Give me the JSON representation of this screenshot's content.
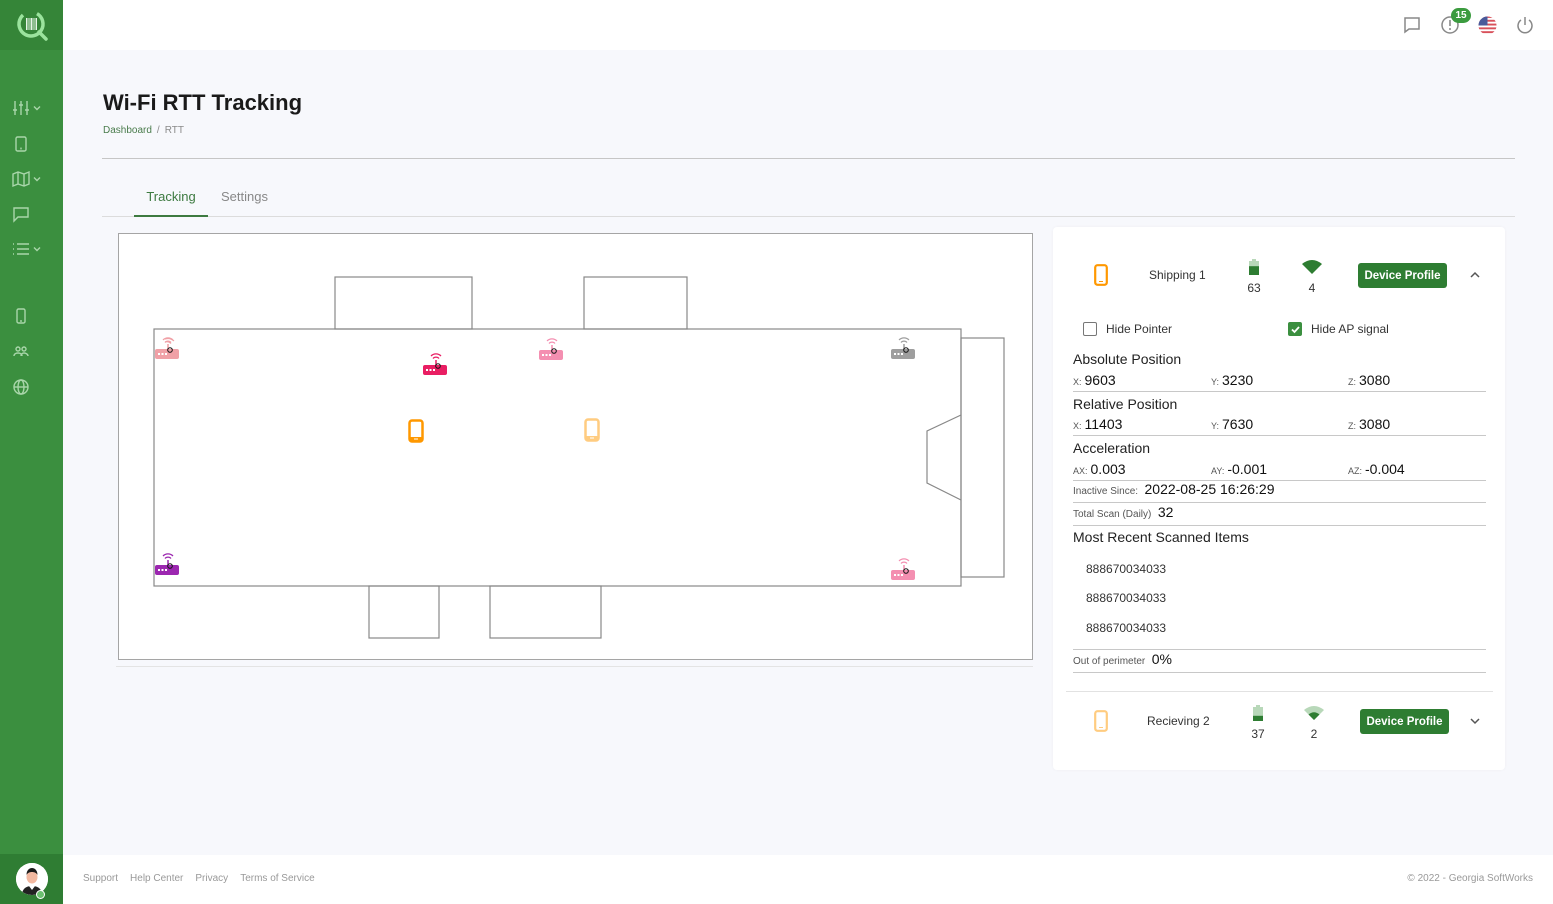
{
  "app": {
    "brand_color": "#3b8f3f",
    "accent": "#2e7d32"
  },
  "sidebar": {
    "logo_icon": "barcode-search-logo",
    "items": [
      {
        "name": "sliders-icon",
        "has_submenu": true
      },
      {
        "name": "tablet-icon",
        "has_submenu": false
      },
      {
        "name": "map-icon",
        "has_submenu": true
      },
      {
        "name": "chat-icon",
        "has_submenu": false
      },
      {
        "name": "list-icon",
        "has_submenu": true
      },
      {
        "name": "phone-icon",
        "has_submenu": false
      },
      {
        "name": "users-icon",
        "has_submenu": false
      },
      {
        "name": "globe-icon",
        "has_submenu": false
      }
    ]
  },
  "topbar": {
    "notifications_count": "15",
    "icons": [
      "message-icon",
      "alert-icon",
      "us-flag-icon",
      "power-icon"
    ]
  },
  "header": {
    "title": "Wi-Fi RTT Tracking",
    "breadcrumb": [
      {
        "label": "Dashboard"
      },
      {
        "label": "RTT"
      }
    ]
  },
  "tabs": [
    {
      "label": "Tracking",
      "active": true
    },
    {
      "label": "Settings",
      "active": false
    }
  ],
  "map": {
    "access_points": [
      {
        "color": "#f0a0a6"
      },
      {
        "color": "#e91e63"
      },
      {
        "color": "#f48fb1"
      },
      {
        "color": "#9e9e9e"
      },
      {
        "color": "#9c27b0"
      },
      {
        "color": "#f48fb1"
      }
    ],
    "devices": [
      {
        "color": "#ff9800"
      },
      {
        "color": "#ffcc80"
      }
    ]
  },
  "panel": {
    "devices": [
      {
        "name": "Shipping 1",
        "battery": "63",
        "battery_level": 0.63,
        "signal": "4",
        "button": "Device Profile",
        "expanded": true,
        "phone_color": "#ff9800"
      },
      {
        "name": "Recieving 2",
        "battery": "37",
        "battery_level": 0.37,
        "signal": "2",
        "button": "Device Profile",
        "expanded": false,
        "phone_color": "#ffcc80"
      }
    ],
    "options": {
      "hide_pointer": "Hide Pointer",
      "hide_pointer_checked": false,
      "hide_ap_signal": "Hide AP signal",
      "hide_ap_signal_checked": true
    },
    "absolute_position": {
      "title": "Absolute Position",
      "x_label": "X:",
      "x": "9603",
      "y_label": "Y:",
      "y": "3230",
      "z_label": "Z:",
      "z": "3080"
    },
    "relative_position": {
      "title": "Relative Position",
      "x_label": "X:",
      "x": "11403",
      "y_label": "Y:",
      "y": "7630",
      "z_label": "Z:",
      "z": "3080"
    },
    "acceleration": {
      "title": "Acceleration",
      "ax_label": "AX:",
      "ax": "0.003",
      "ay_label": "AY:",
      "ay": "-0.001",
      "az_label": "AZ:",
      "az": "-0.004"
    },
    "inactive_since": {
      "label": "Inactive Since:",
      "value": "2022-08-25 16:26:29"
    },
    "total_scan": {
      "label": "Total Scan (Daily)",
      "value": "32"
    },
    "recent_scans": {
      "title": "Most Recent Scanned Items",
      "items": [
        "888670034033",
        "888670034033",
        "888670034033"
      ]
    },
    "out_of_perimeter": {
      "label": "Out of perimeter",
      "value": "0%"
    }
  },
  "footer": {
    "links": [
      "Support",
      "Help Center",
      "Privacy",
      "Terms of Service"
    ],
    "copyright": "© 2022 - Georgia SoftWorks"
  }
}
